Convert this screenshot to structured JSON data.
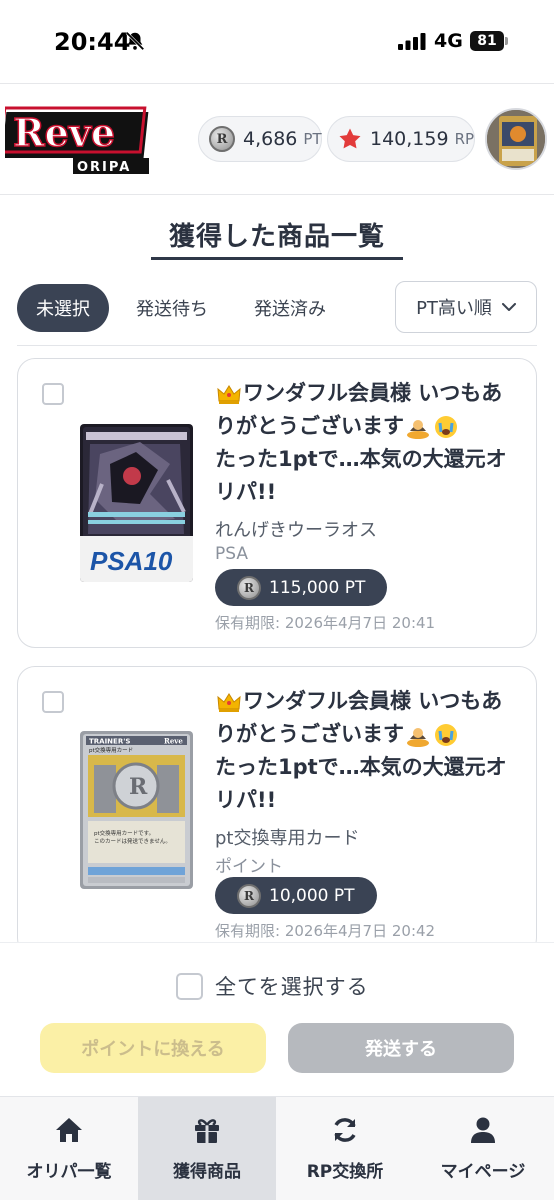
{
  "status_bar": {
    "time": "20:44",
    "network": "4G",
    "battery": "81"
  },
  "header": {
    "logo_text": "Reve",
    "logo_sub": "ORIPA",
    "pt": {
      "coin_glyph": "R",
      "value": "4,686",
      "unit": "PT"
    },
    "rp": {
      "value": "140,159",
      "unit": "RP"
    }
  },
  "page_title": "獲得した商品一覧",
  "tabs": [
    {
      "label": "未選択",
      "active": true
    },
    {
      "label": "発送待ち",
      "active": false
    },
    {
      "label": "発送済み",
      "active": false
    }
  ],
  "sort": {
    "label": "PT高い順"
  },
  "items": [
    {
      "title_part1": "ワンダフル会員様 いつもありがとうございます",
      "title_part2": "たった1ptで…本気の大還元オリパ!!",
      "name": "れんげきウーラオス",
      "category": "PSA",
      "price": "115,000 PT",
      "expiry": "保有期限: 2026年4月7日 20:41",
      "card_grade": "PSA10"
    },
    {
      "title_part1": "ワンダフル会員様 いつもありがとうございます",
      "title_part2": "たった1ptで…本気の大還元オリパ!!",
      "name": "pt交換専用カード",
      "category": "ポイント",
      "price": "10,000 PT",
      "expiry": "保有期限: 2026年4月7日 20:42",
      "card_header": "pt交換専用カード",
      "card_text1": "pt交換専用カードです。",
      "card_text2": "このカードは発送できません。",
      "card_brand": "Reve",
      "card_trainer": "TRAINER'S"
    }
  ],
  "actions": {
    "select_all": "全てを選択する",
    "convert_label": "ポイントに換える",
    "ship_label": "発送する"
  },
  "nav": [
    {
      "label": "オリパ一覧",
      "icon": "home-icon",
      "active": false
    },
    {
      "label": "獲得商品",
      "icon": "gift-icon",
      "active": true
    },
    {
      "label": "RP交換所",
      "icon": "refresh-icon",
      "active": false
    },
    {
      "label": "マイページ",
      "icon": "user-icon",
      "active": false
    }
  ],
  "colors": {
    "primary_dark": "#3a4354",
    "convert_bg": "#fbf0a6",
    "ship_bg": "#b6b9be",
    "star": "#e23b3b"
  }
}
